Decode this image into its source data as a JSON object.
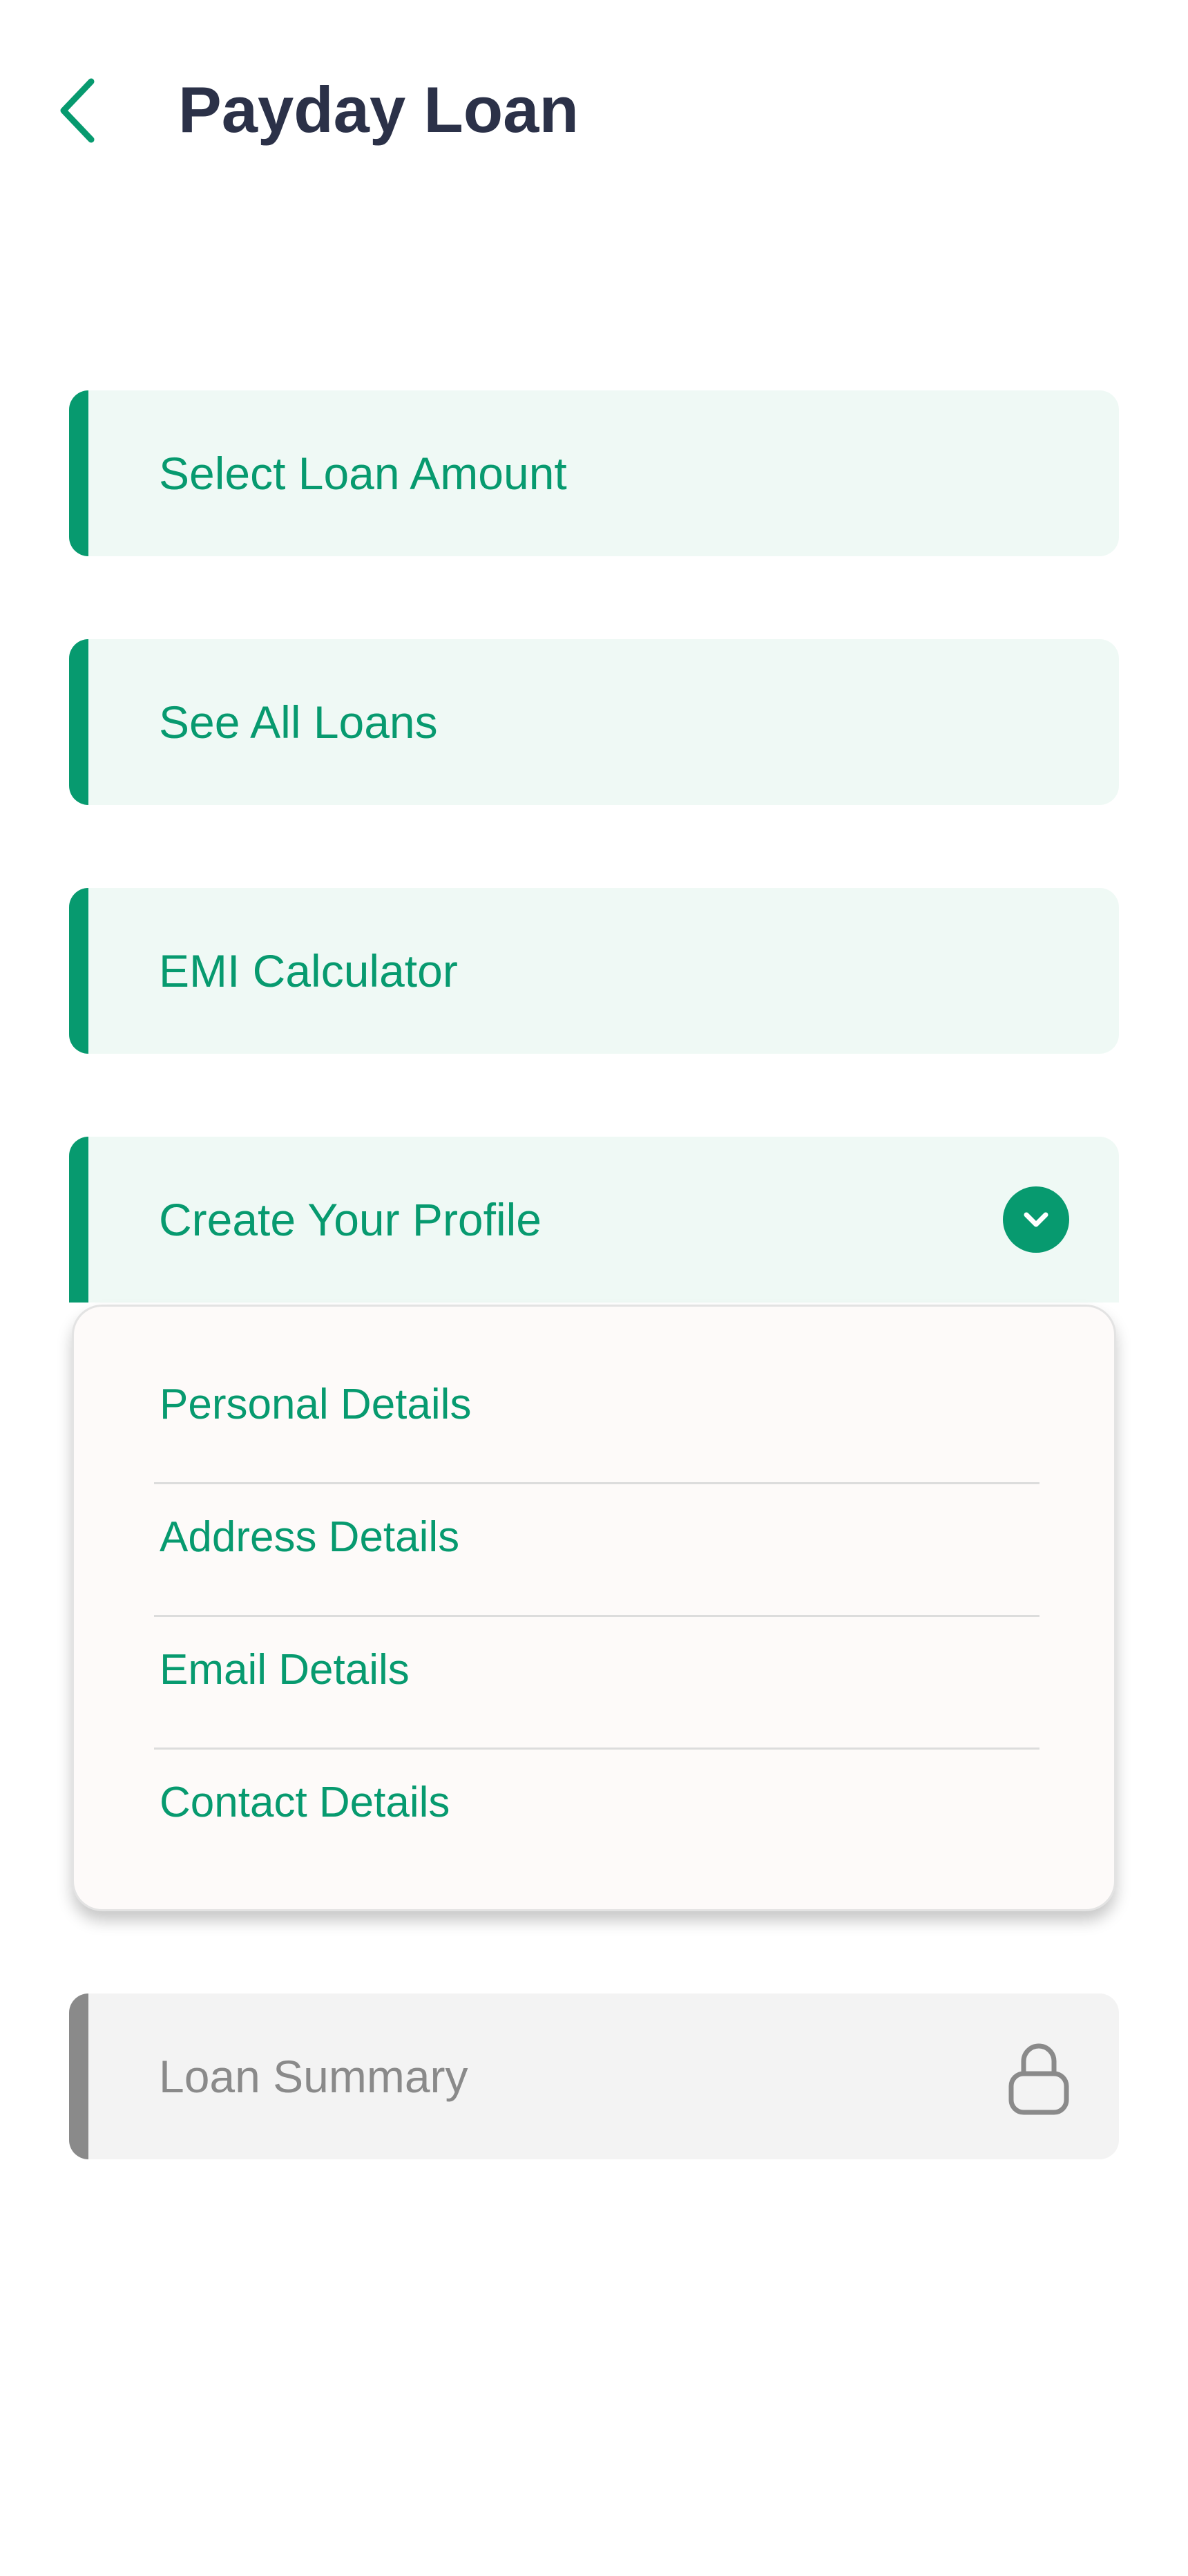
{
  "header": {
    "title": "Payday Loan",
    "back_icon": "chevron-left-icon"
  },
  "menu": {
    "items": [
      {
        "label": "Select Loan Amount"
      },
      {
        "label": "See All Loans"
      },
      {
        "label": "EMI Calculator"
      },
      {
        "label": "Create Your Profile",
        "expanded": true,
        "icon": "chevron-down-icon"
      }
    ]
  },
  "profile_submenu": {
    "items": [
      {
        "label": "Personal Details"
      },
      {
        "label": "Address Details"
      },
      {
        "label": "Email Details"
      },
      {
        "label": "Contact Details"
      }
    ]
  },
  "locked_item": {
    "label": "Loan Summary",
    "icon": "lock-icon",
    "locked": true
  },
  "colors": {
    "accent": "#079a6f",
    "item_background": "#eff9f5",
    "title_text": "#2b3148",
    "disabled": "#8a8a8a",
    "disabled_background": "#f3f3f3"
  }
}
